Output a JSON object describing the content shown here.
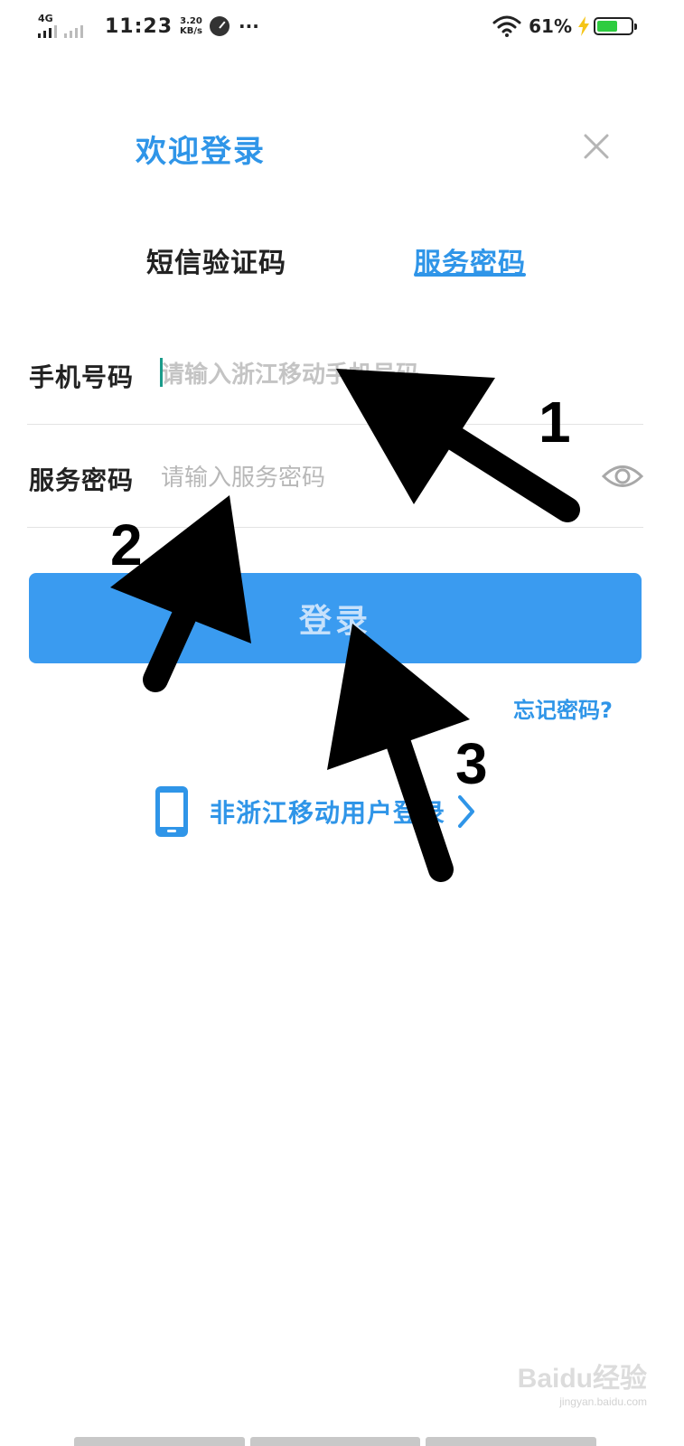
{
  "status_bar": {
    "network": "4G",
    "time": "11:23",
    "speed_value": "3.20",
    "speed_unit": "KB/s",
    "more": "···",
    "battery_percent": "61%",
    "battery_level": 0.61,
    "battery_color": "#2ecc40"
  },
  "header": {
    "title": "欢迎登录",
    "close_icon": "close-icon"
  },
  "tabs": [
    {
      "label": "短信验证码",
      "active": false
    },
    {
      "label": "服务密码",
      "active": true
    }
  ],
  "form": {
    "phone": {
      "label": "手机号码",
      "placeholder": "请输入浙江移动手机号码",
      "value": ""
    },
    "password": {
      "label": "服务密码",
      "placeholder": "请输入服务密码",
      "value": ""
    },
    "submit_label": "登录",
    "forgot_label": "忘记密码?"
  },
  "other_login": {
    "label": "非浙江移动用户登录"
  },
  "annotations": [
    "1",
    "2",
    "3"
  ],
  "watermark": {
    "logo": "Baidu经验",
    "site": "jingyan.baidu.com"
  },
  "colors": {
    "accent": "#2f95e8",
    "button": "#3a9bf0"
  }
}
